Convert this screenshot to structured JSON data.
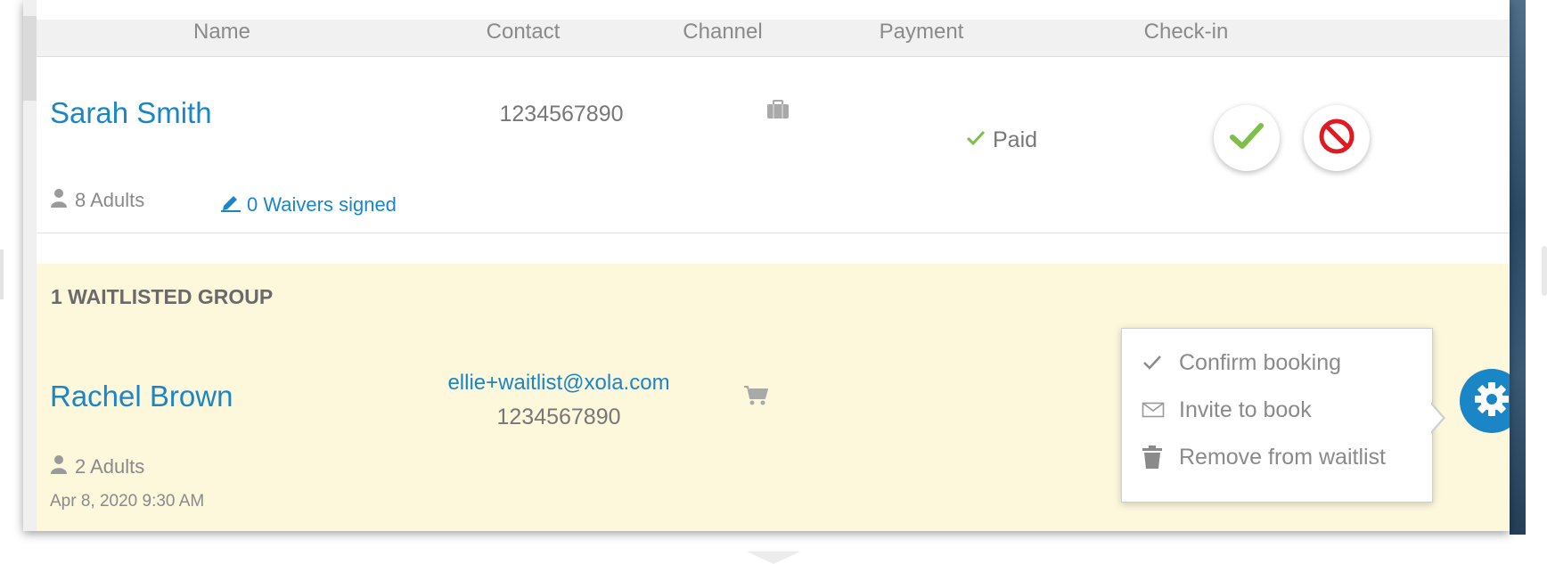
{
  "table": {
    "columns": [
      "Name",
      "Contact",
      "Channel",
      "Payment",
      "Check-in"
    ]
  },
  "booking": {
    "name": "Sarah Smith",
    "phone": "1234567890",
    "channel_icon": "briefcase-icon",
    "payment_status": "Paid",
    "guests": "8 Adults",
    "waivers": "0 Waivers signed",
    "checkin_actions": [
      "check-in-confirm",
      "check-in-cancel"
    ]
  },
  "waitlist": {
    "heading": "1 WAITLISTED GROUP",
    "name": "Rachel Brown",
    "email": "ellie+waitlist@xola.com",
    "phone": "1234567890",
    "channel_icon": "cart-icon",
    "guests": "2 Adults",
    "date": "Apr 8, 2020 9:30 AM"
  },
  "menu": {
    "items": [
      {
        "label": "Confirm booking",
        "icon": "check-icon"
      },
      {
        "label": "Invite to book",
        "icon": "envelope-icon"
      },
      {
        "label": "Remove from waitlist",
        "icon": "trash-icon"
      }
    ]
  },
  "colors": {
    "link": "#1a86c6",
    "waitlist_bg": "#fdf7dc",
    "success": "#7cc04a",
    "danger": "#e01a22"
  }
}
